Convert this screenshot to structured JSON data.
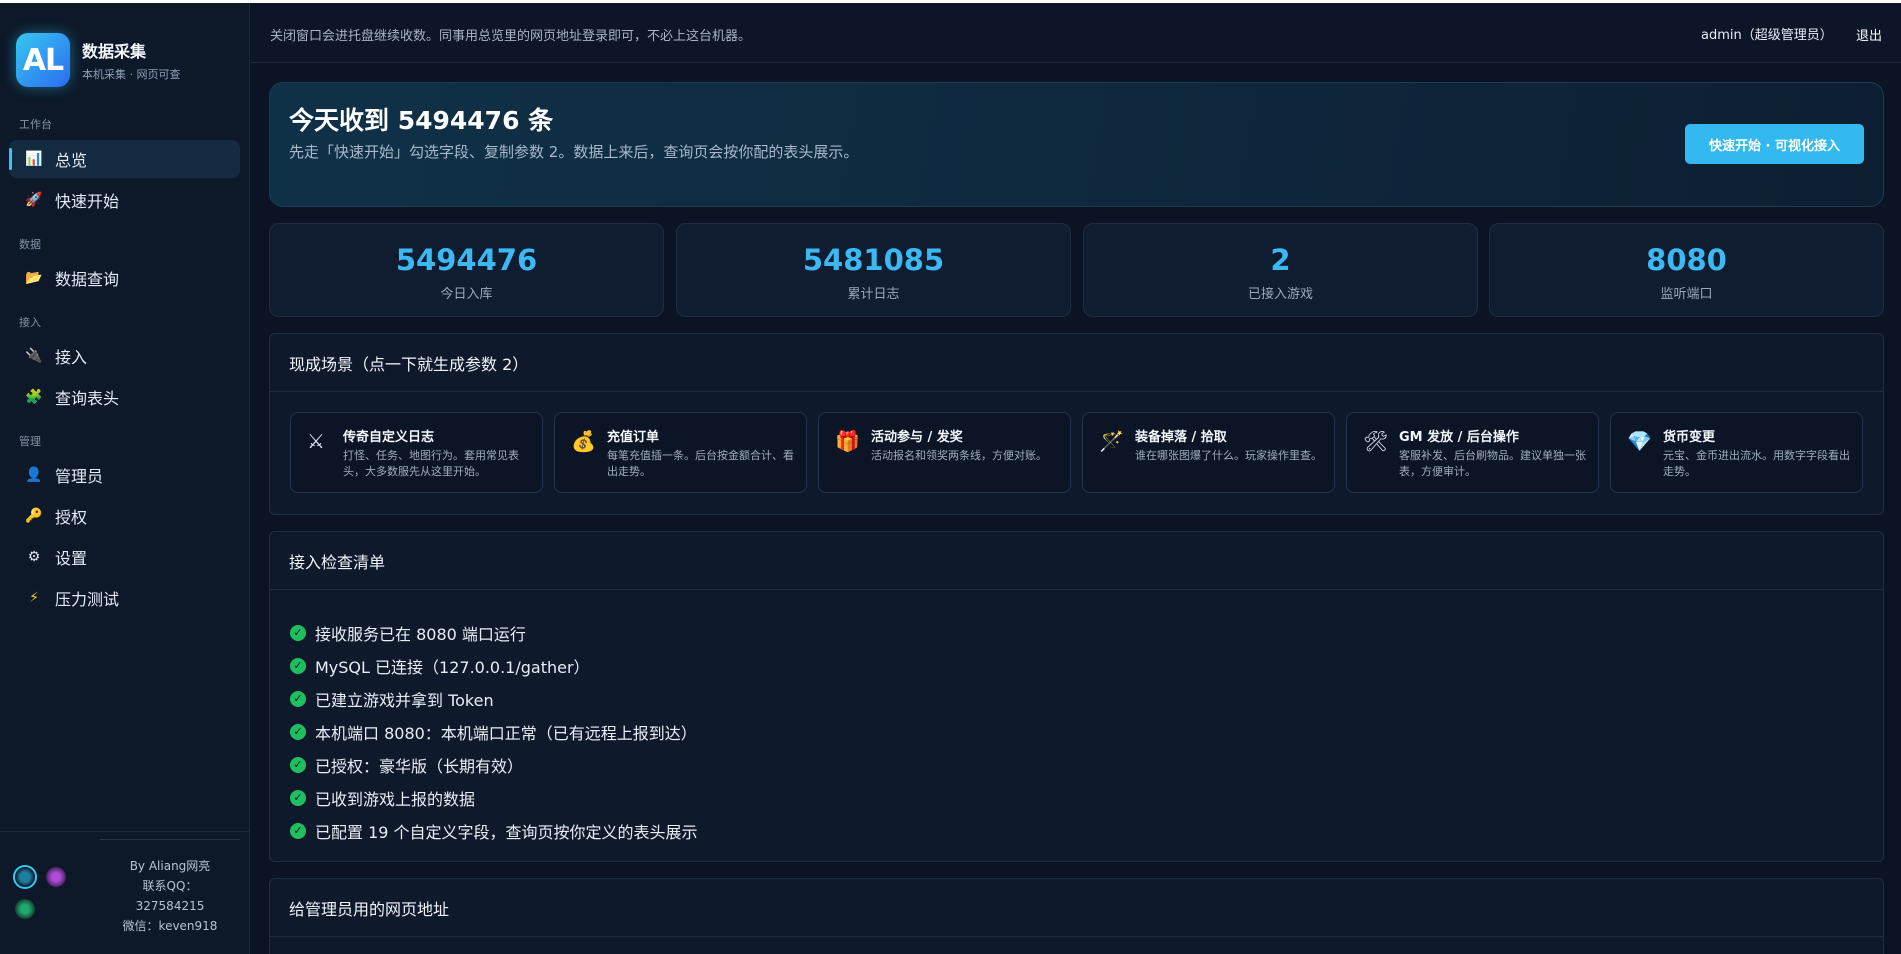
{
  "brand": {
    "logo_text": "AL",
    "title": "数据采集",
    "subtitle": "本机采集 · 网页可查"
  },
  "sidebar": {
    "groups": {
      "workbench": "工作台",
      "data": "数据",
      "access": "接入",
      "admin": "管理"
    },
    "items": [
      {
        "label": "总览",
        "icon": "chart-icon",
        "active": true
      },
      {
        "label": "快速开始",
        "icon": "rocket-icon"
      },
      {
        "label": "数据查询",
        "icon": "folder-icon"
      },
      {
        "label": "接入",
        "icon": "plug-icon"
      },
      {
        "label": "查询表头",
        "icon": "puzzle-icon"
      },
      {
        "label": "管理员",
        "icon": "user-icon"
      },
      {
        "label": "授权",
        "icon": "key-icon"
      },
      {
        "label": "设置",
        "icon": "gear-icon"
      },
      {
        "label": "压力测试",
        "icon": "lightning-icon"
      }
    ],
    "footer": {
      "author": "By Aliang网亮",
      "qq_label": "联系QQ：",
      "qq": "327584215",
      "wechat": "微信：keven918"
    }
  },
  "header": {
    "hint": "关闭窗口会进托盘继续收数。同事用总览里的网页地址登录即可，不必上这台机器。",
    "user": "admin（超级管理员）",
    "logout": "退出"
  },
  "hero": {
    "title": "今天收到 5494476 条",
    "desc": "先走「快速开始」勾选字段、复制参数 2。数据上来后，查询页会按你配的表头展示。",
    "button": "快速开始 · 可视化接入"
  },
  "stats": [
    {
      "value": "5494476",
      "label": "今日入库"
    },
    {
      "value": "5481085",
      "label": "累计日志"
    },
    {
      "value": "2",
      "label": "已接入游戏"
    },
    {
      "value": "8080",
      "label": "监听端口"
    }
  ],
  "scenes": {
    "title": "现成场景（点一下就生成参数 2）",
    "items": [
      {
        "icon": "⚔",
        "title": "传奇自定义日志",
        "desc": "打怪、任务、地图行为。套用常见表头，大多数服先从这里开始。"
      },
      {
        "icon": "💰",
        "title": "充值订单",
        "desc": "每笔充值插一条。后台按金额合计、看出走势。"
      },
      {
        "icon": "🎁",
        "title": "活动参与 / 发奖",
        "desc": "活动报名和领奖两条线，方便对账。"
      },
      {
        "icon": "🪄",
        "title": "装备掉落 / 拾取",
        "desc": "谁在哪张图爆了什么。玩家操作里查。"
      },
      {
        "icon": "🛠",
        "title": "GM 发放 / 后台操作",
        "desc": "客服补发、后台刷物品。建议单独一张表，方便审计。"
      },
      {
        "icon": "💎",
        "title": "货币变更",
        "desc": "元宝、金币进出流水。用数字字段看出走势。"
      }
    ]
  },
  "checklist": {
    "title": "接入检查清单",
    "items": [
      "接收服务已在 8080 端口运行",
      "MySQL 已连接（127.0.0.1/gather）",
      "已建立游戏并拿到 Token",
      "本机端口 8080：本机端口正常（已有远程上报到达）",
      "已授权：豪华版（长期有效）",
      "已收到游戏上报的数据",
      "已配置 19 个自定义字段，查询页按你定义的表头展示"
    ]
  },
  "admin_url": {
    "title": "给管理员用的网页地址"
  }
}
